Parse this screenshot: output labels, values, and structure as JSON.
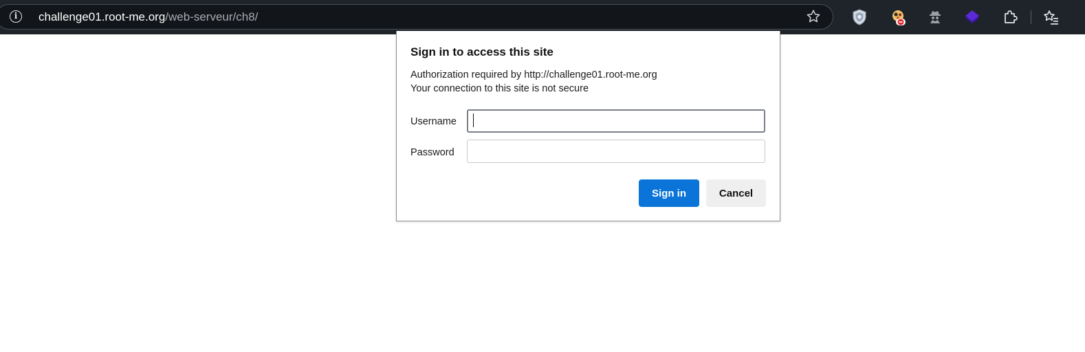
{
  "browser": {
    "url_host": "challenge01.root-me.org",
    "url_path": "/web-serveur/ch8/",
    "info_icon": "info-icon",
    "bookmark_icon": "star-icon",
    "extensions": [
      {
        "name": "shield-extension-icon"
      },
      {
        "name": "blocked-extension-icon",
        "badge_color": "#e0262b"
      },
      {
        "name": "spy-extension-icon"
      },
      {
        "name": "purple-extension-icon",
        "color": "#5b2ad6"
      },
      {
        "name": "puzzle-extensions-icon"
      },
      {
        "name": "favorites-icon"
      }
    ]
  },
  "dialog": {
    "title": "Sign in to access this site",
    "auth_line": "Authorization required by http://challenge01.root-me.org",
    "security_line": "Your connection to this site is not secure",
    "username_label": "Username",
    "username_value": "",
    "password_label": "Password",
    "password_value": "",
    "sign_in_label": "Sign in",
    "cancel_label": "Cancel",
    "primary_color": "#0a74d8"
  }
}
